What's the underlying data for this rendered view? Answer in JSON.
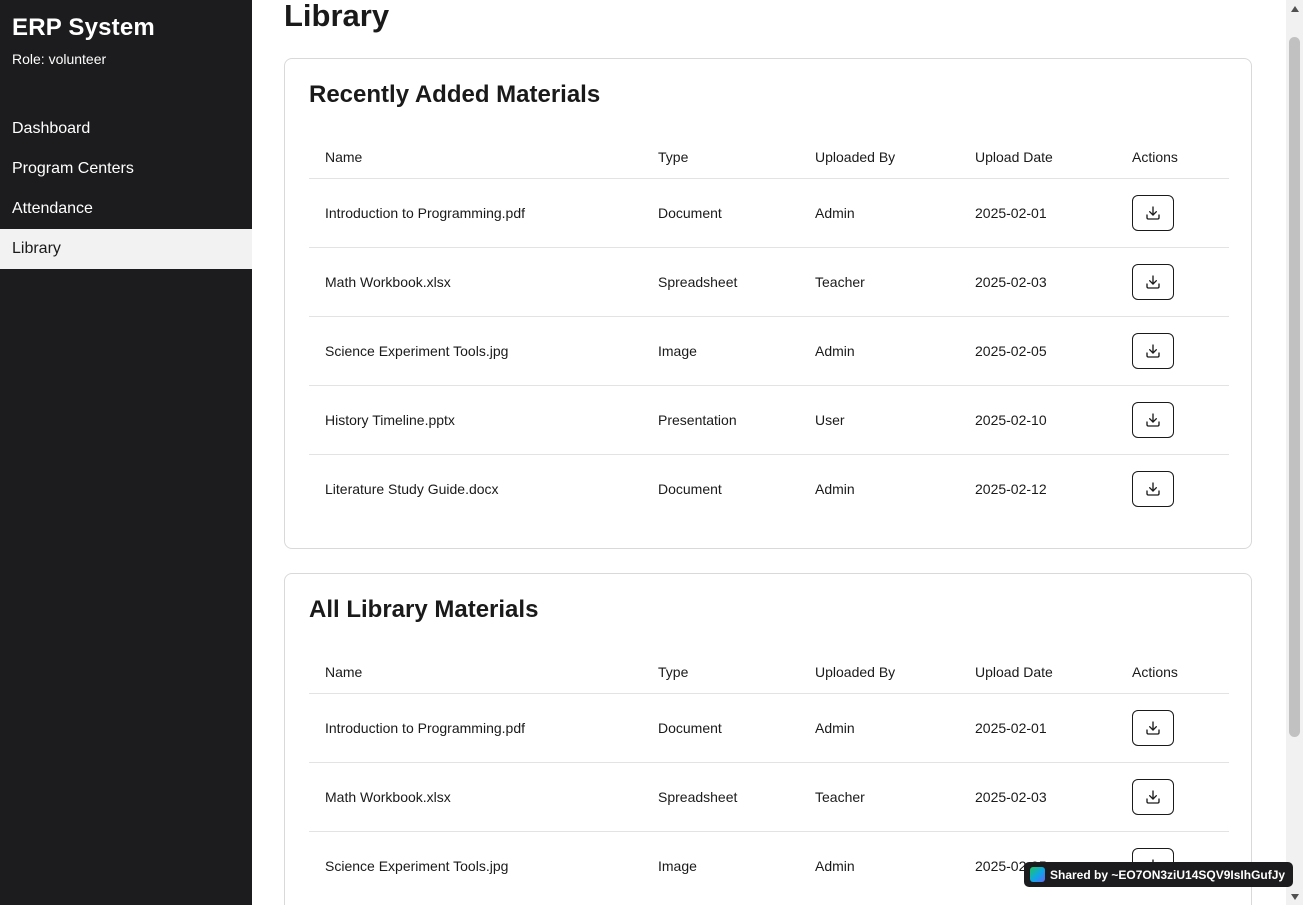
{
  "sidebar": {
    "title": "ERP System",
    "role": "Role: volunteer",
    "items": [
      {
        "label": "Dashboard",
        "active": false
      },
      {
        "label": "Program Centers",
        "active": false
      },
      {
        "label": "Attendance",
        "active": false
      },
      {
        "label": "Library",
        "active": true
      }
    ]
  },
  "main": {
    "page_title": "Library",
    "recent": {
      "title": "Recently Added Materials",
      "columns": [
        "Name",
        "Type",
        "Uploaded By",
        "Upload Date",
        "Actions"
      ],
      "rows": [
        {
          "name": "Introduction to Programming.pdf",
          "type": "Document",
          "uploaded_by": "Admin",
          "date": "2025-02-01",
          "action_icon": "download-icon"
        },
        {
          "name": "Math Workbook.xlsx",
          "type": "Spreadsheet",
          "uploaded_by": "Teacher",
          "date": "2025-02-03",
          "action_icon": "download-icon"
        },
        {
          "name": "Science Experiment Tools.jpg",
          "type": "Image",
          "uploaded_by": "Admin",
          "date": "2025-02-05",
          "action_icon": "download-icon"
        },
        {
          "name": "History Timeline.pptx",
          "type": "Presentation",
          "uploaded_by": "User",
          "date": "2025-02-10",
          "action_icon": "download-icon"
        },
        {
          "name": "Literature Study Guide.docx",
          "type": "Document",
          "uploaded_by": "Admin",
          "date": "2025-02-12",
          "action_icon": "download-icon"
        }
      ]
    },
    "all": {
      "title": "All Library Materials",
      "columns": [
        "Name",
        "Type",
        "Uploaded By",
        "Upload Date",
        "Actions"
      ],
      "rows": [
        {
          "name": "Introduction to Programming.pdf",
          "type": "Document",
          "uploaded_by": "Admin",
          "date": "2025-02-01",
          "action_icon": "download-icon"
        },
        {
          "name": "Math Workbook.xlsx",
          "type": "Spreadsheet",
          "uploaded_by": "Teacher",
          "date": "2025-02-03",
          "action_icon": "download-icon"
        },
        {
          "name": "Science Experiment Tools.jpg",
          "type": "Image",
          "uploaded_by": "Admin",
          "date": "2025-02-05",
          "action_icon": "download-icon"
        }
      ]
    }
  },
  "share_badge": {
    "text": "Shared by ~EO7ON3ziU14SQV9IsIhGufJy"
  },
  "colors": {
    "sidebar_bg": "#1c1c1e",
    "active_item_bg": "#f2f2f2",
    "border": "#d9d9d9"
  }
}
